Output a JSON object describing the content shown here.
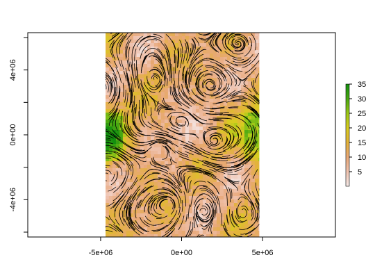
{
  "chart_data": {
    "type": "heatmap",
    "title": "",
    "xlabel": "",
    "ylabel": "",
    "xlim": [
      -9500000,
      9500000
    ],
    "ylim": [
      -6300000,
      6300000
    ],
    "data_extent": {
      "x": [
        -4700000,
        4800000
      ],
      "y": [
        -6300000,
        6300000
      ]
    },
    "x_ticks": [
      {
        "value": -5000000,
        "label": "-5e+06"
      },
      {
        "value": 0,
        "label": "0e+00"
      },
      {
        "value": 5000000,
        "label": "5e+06"
      }
    ],
    "y_ticks": [
      {
        "value": -4000000,
        "label": "-4e+06"
      },
      {
        "value": 0,
        "label": "0e+00"
      },
      {
        "value": 4000000,
        "label": "4e+06"
      }
    ],
    "y_minor_ticks": [
      -6000000,
      -2000000,
      2000000,
      6000000
    ],
    "colorbar": {
      "range": [
        0,
        35
      ],
      "ticks": [
        {
          "value": 5,
          "label": "5"
        },
        {
          "value": 10,
          "label": "10"
        },
        {
          "value": 15,
          "label": "15"
        },
        {
          "value": 20,
          "label": "20"
        },
        {
          "value": 25,
          "label": "25"
        },
        {
          "value": 30,
          "label": "30"
        },
        {
          "value": 35,
          "label": "35"
        }
      ],
      "color_stops": [
        {
          "value": 0,
          "color": "#f4e8e6"
        },
        {
          "value": 5,
          "color": "#efc3b0"
        },
        {
          "value": 10,
          "color": "#e8a878"
        },
        {
          "value": 15,
          "color": "#e3b33a"
        },
        {
          "value": 20,
          "color": "#d8cc20"
        },
        {
          "value": 25,
          "color": "#9cc818"
        },
        {
          "value": 30,
          "color": "#4aa812"
        },
        {
          "value": 35,
          "color": "#138f0f"
        }
      ]
    },
    "overlay": "streamlines",
    "overlay_color": "#000000",
    "grid": false,
    "legend": "right"
  }
}
